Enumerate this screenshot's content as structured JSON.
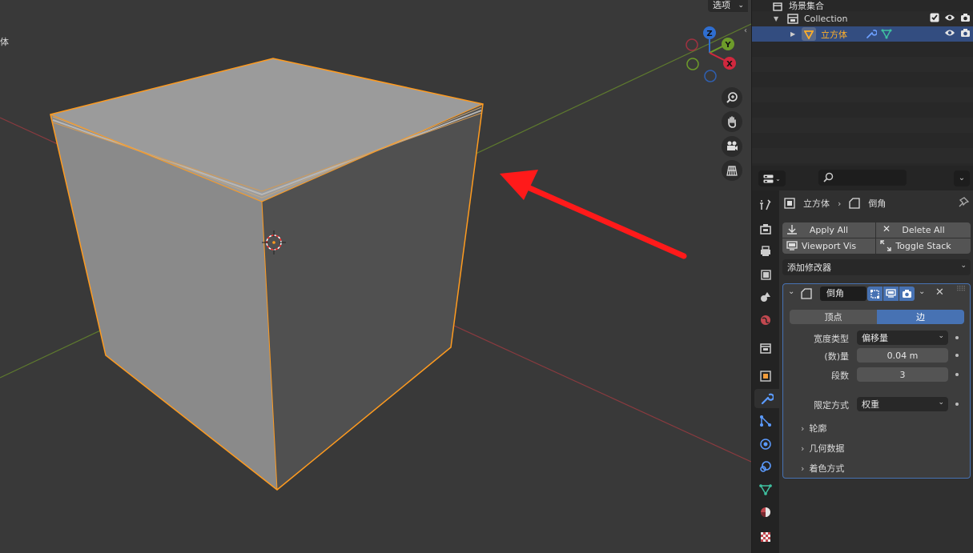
{
  "viewport": {
    "options_label": "选项",
    "side_text": "体",
    "gizmo_axes": {
      "z": "Z",
      "y": "Y",
      "x": "X"
    },
    "nav_icons": [
      "zoom-icon",
      "hand-pan-icon",
      "camera-icon",
      "grid-ortho-icon"
    ],
    "arrow_color": "#ff1a1a",
    "selection_color": "#ff9b1f"
  },
  "outliner": {
    "scene_collection": "场景集合",
    "collection": "Collection",
    "object": "立方体"
  },
  "properties": {
    "breadcrumb_object": "立方体",
    "breadcrumb_modifier": "倒角",
    "apply_all": "Apply All",
    "delete_all": "Delete All",
    "viewport_vis": "Viewport Vis",
    "toggle_stack": "Toggle Stack",
    "add_modifier": "添加修改器",
    "modifier": {
      "name": "倒角",
      "affect_options": [
        "顶点",
        "边"
      ],
      "affect_selected": "边",
      "width_type_label": "宽度类型",
      "width_type_value": "偏移量",
      "amount_label": "(数)量",
      "amount_value": "0.04 m",
      "segments_label": "段数",
      "segments_value": "3",
      "limit_method_label": "限定方式",
      "limit_method_value": "权重",
      "subpanels": [
        "轮廓",
        "几何数据",
        "着色方式"
      ]
    }
  }
}
